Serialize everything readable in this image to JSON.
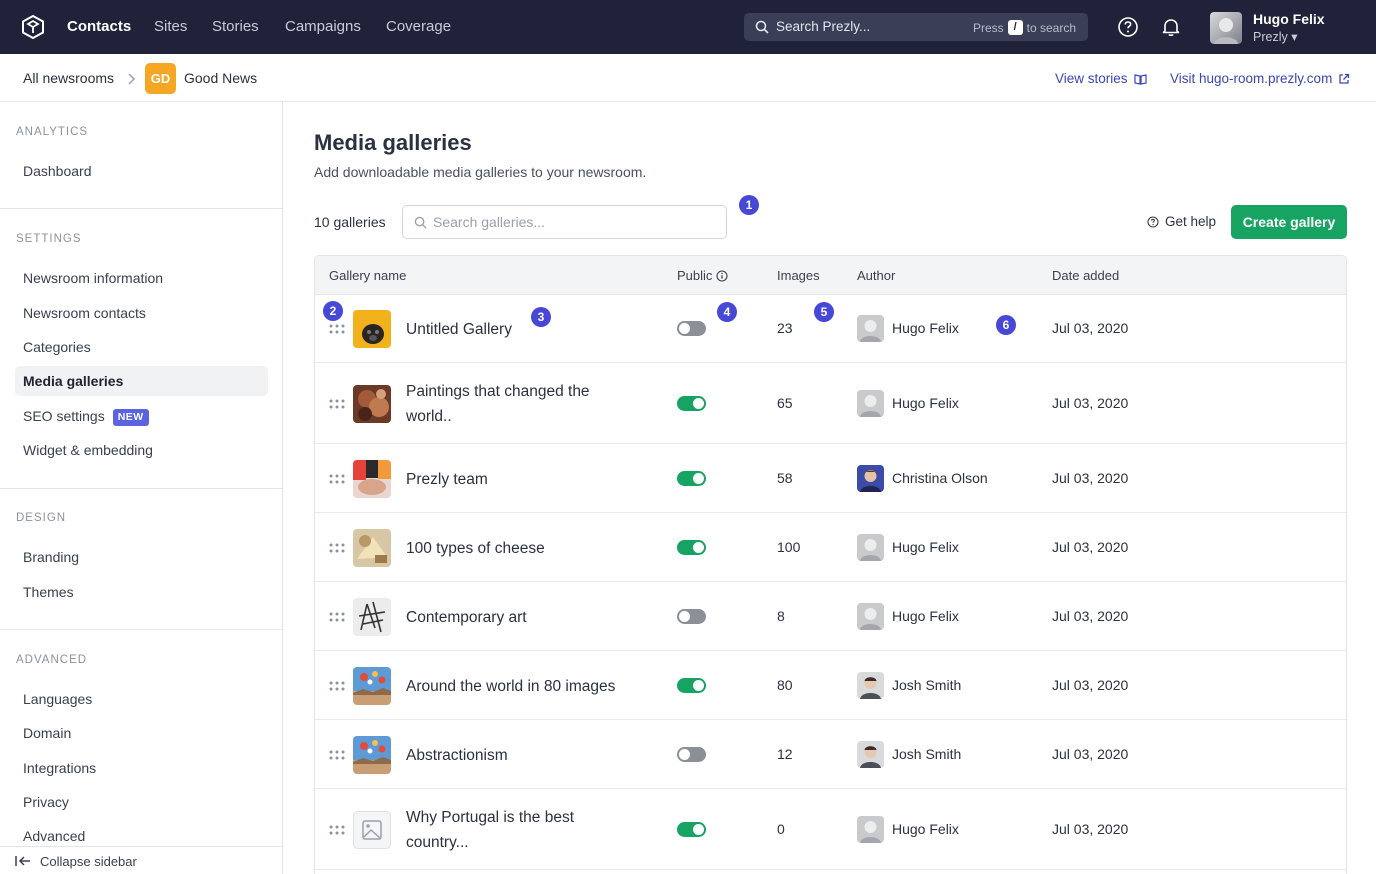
{
  "topnav": {
    "items": [
      "Contacts",
      "Sites",
      "Stories",
      "Campaigns",
      "Coverage"
    ],
    "search_placeholder": "Search Prezly...",
    "search_hint_press": "Press",
    "search_hint_key": "/",
    "search_hint_to": "to search",
    "user_name": "Hugo Felix",
    "user_org": "Prezly ▾"
  },
  "breadcrumb": {
    "root": "All newsrooms",
    "badge": "GD",
    "current": "Good News",
    "view_stories": "View stories",
    "visit": "Visit hugo-room.prezly.com"
  },
  "sidebar": {
    "analytics_label": "ANALYTICS",
    "analytics_items": [
      "Dashboard"
    ],
    "settings_label": "SETTINGS",
    "settings_items": [
      "Newsroom information",
      "Newsroom contacts",
      "Categories",
      "Media galleries",
      "SEO settings",
      "Widget & embedding"
    ],
    "new_badge": "NEW",
    "design_label": "DESIGN",
    "design_items": [
      "Branding",
      "Themes"
    ],
    "advanced_label": "ADVANCED",
    "advanced_items": [
      "Languages",
      "Domain",
      "Integrations",
      "Privacy",
      "Advanced"
    ],
    "collapse": "Collapse sidebar",
    "active_item": "Media galleries"
  },
  "main": {
    "title": "Media galleries",
    "subtitle": "Add downloadable media galleries to your newsroom.",
    "count": "10 galleries",
    "search_placeholder": "Search galleries...",
    "get_help": "Get help",
    "create": "Create gallery"
  },
  "annotations": [
    "1",
    "2",
    "3",
    "4",
    "5",
    "6"
  ],
  "table": {
    "headers": {
      "name": "Gallery name",
      "public": "Public",
      "images": "Images",
      "author": "Author",
      "date": "Date added"
    },
    "rows": [
      {
        "name": "Untitled Gallery",
        "public": false,
        "images": "23",
        "author": "Hugo Felix",
        "date": "Jul 03, 2020",
        "thumb": "pug"
      },
      {
        "name": "Paintings that changed the world..",
        "public": true,
        "images": "65",
        "author": "Hugo Felix",
        "date": "Jul 03, 2020",
        "thumb": "painting"
      },
      {
        "name": "Prezly team",
        "public": true,
        "images": "58",
        "author": "Christina Olson",
        "date": "Jul 03, 2020",
        "thumb": "team"
      },
      {
        "name": "100 types of cheese",
        "public": true,
        "images": "100",
        "author": "Hugo Felix",
        "date": "Jul 03, 2020",
        "thumb": "cheese"
      },
      {
        "name": "Contemporary art",
        "public": false,
        "images": "8",
        "author": "Hugo Felix",
        "date": "Jul 03, 2020",
        "thumb": "sketch"
      },
      {
        "name": "Around the world in 80 images",
        "public": true,
        "images": "80",
        "author": "Josh Smith",
        "date": "Jul 03, 2020",
        "thumb": "balloons"
      },
      {
        "name": "Abstractionism",
        "public": false,
        "images": "12",
        "author": "Josh Smith",
        "date": "Jul 03, 2020",
        "thumb": "balloons"
      },
      {
        "name": "Why Portugal is the best country...",
        "public": true,
        "images": "0",
        "author": "Hugo Felix",
        "date": "Jul 03, 2020",
        "thumb": "placeholder"
      }
    ]
  }
}
